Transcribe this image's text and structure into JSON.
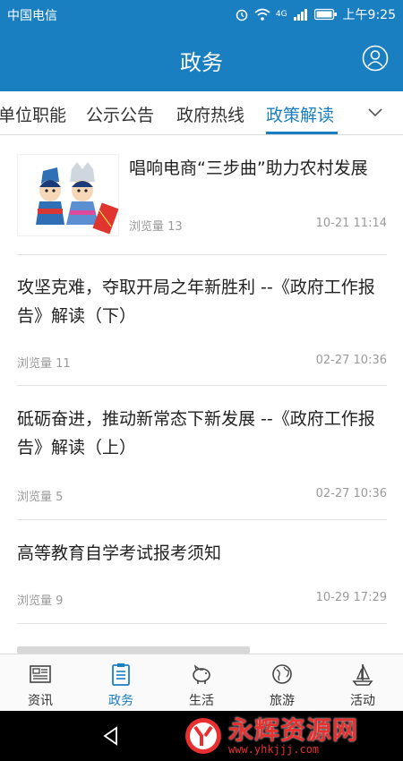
{
  "status": {
    "carrier": "中国电信",
    "time": "上午9:25",
    "network": "4G"
  },
  "header": {
    "title": "政务"
  },
  "tabs": [
    {
      "label": "单位职能"
    },
    {
      "label": "公示公告"
    },
    {
      "label": "政府热线"
    },
    {
      "label": "政策解读",
      "active": true
    }
  ],
  "articles": [
    {
      "title": "唱响电商“三步曲”助力农村发展",
      "views": "浏览量 13",
      "time": "10-21 11:14",
      "has_thumbnail": true
    },
    {
      "title": "攻坚克难，夺取开局之年新胜利 --《政府工作报告》解读（下）",
      "views": "浏览量 11",
      "time": "02-27 10:36"
    },
    {
      "title": "砥砺奋进，推动新常态下新发展 --《政府工作报告》解读（上）",
      "views": "浏览量 5",
      "time": "02-27 10:36"
    },
    {
      "title": "高等教育自学考试报考须知",
      "views": "浏览量 9",
      "time": "10-29 17:29"
    }
  ],
  "bottom_nav": [
    {
      "label": "资讯",
      "icon": "news-icon"
    },
    {
      "label": "政务",
      "icon": "document-icon",
      "active": true
    },
    {
      "label": "生活",
      "icon": "piggy-bank-icon"
    },
    {
      "label": "旅游",
      "icon": "globe-icon"
    },
    {
      "label": "活动",
      "icon": "sailboat-icon"
    }
  ],
  "watermark": {
    "title": "永辉资源网",
    "url": "www.yhkjjj.com"
  },
  "colors": {
    "brand": "#1a7fc0",
    "text": "#222222",
    "meta": "#9a9a9a",
    "watermark": "#e83030"
  }
}
